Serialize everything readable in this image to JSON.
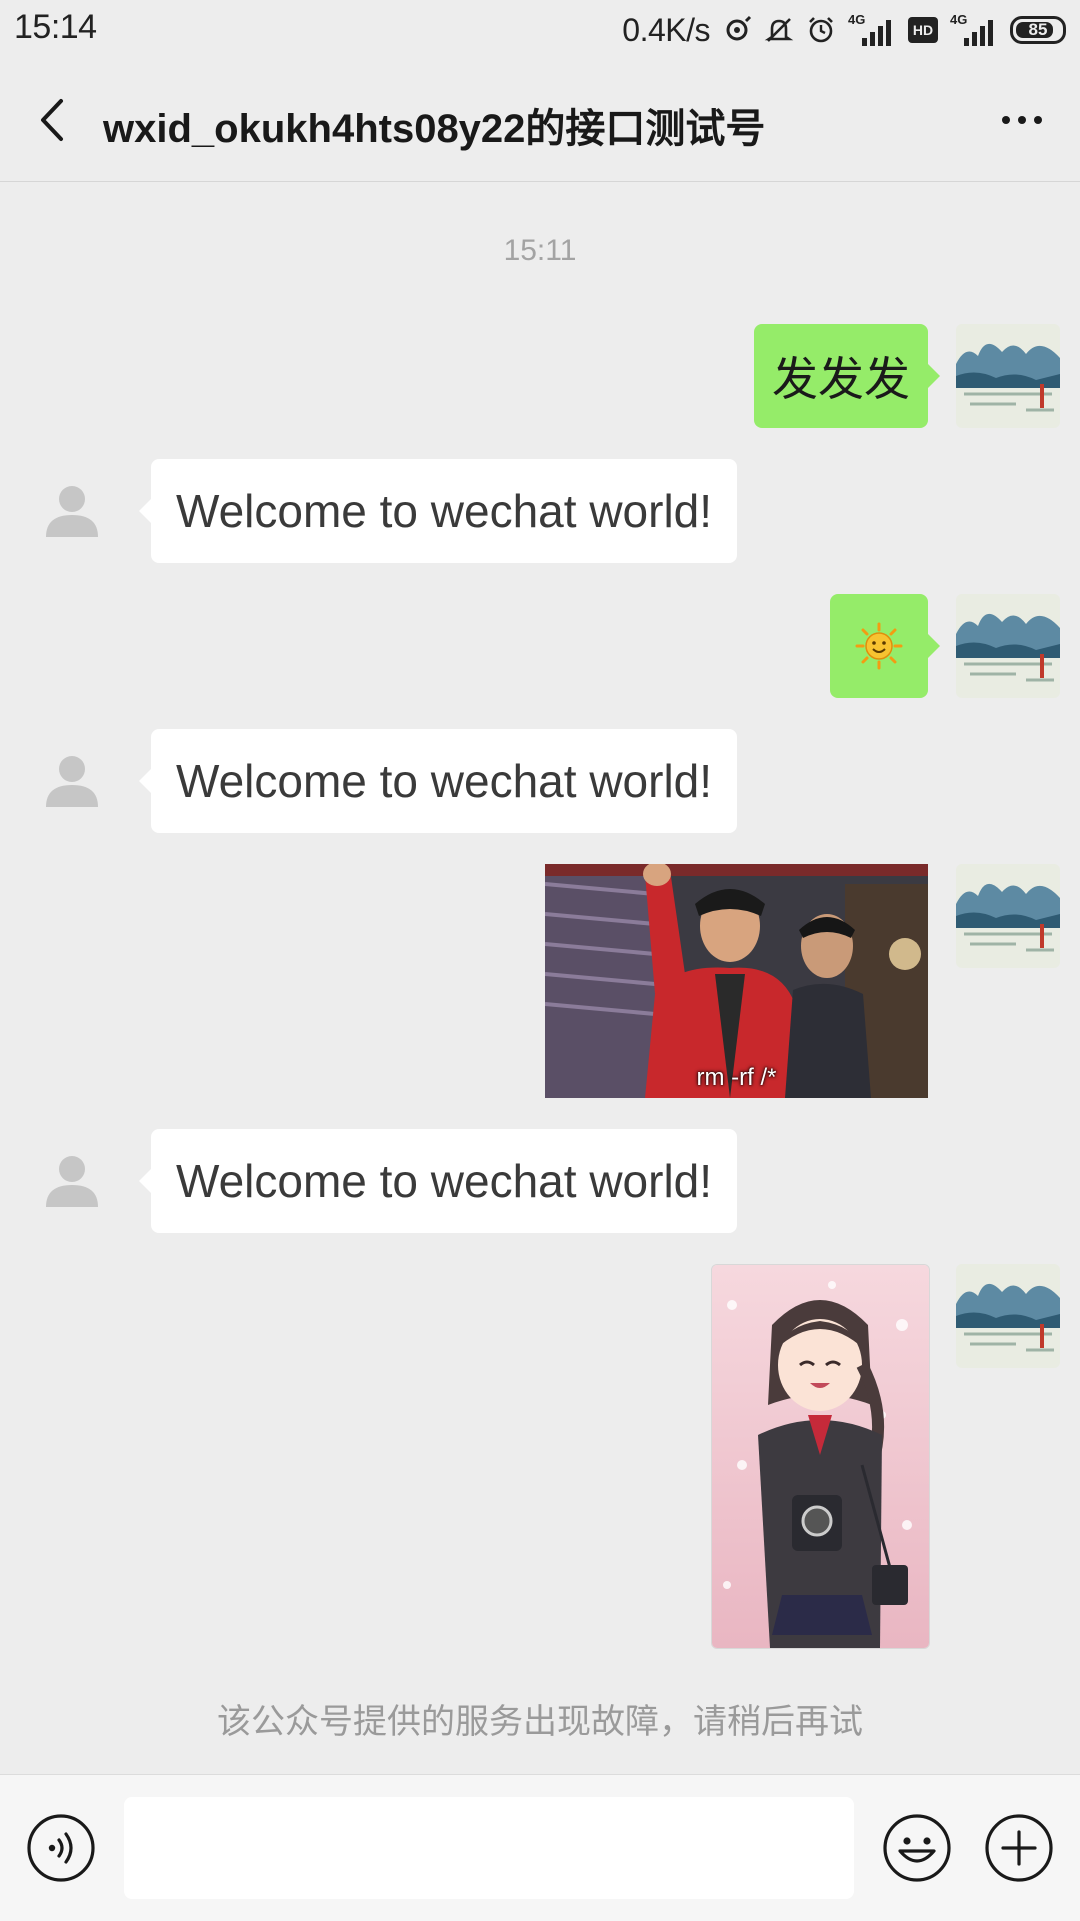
{
  "status_bar": {
    "time": "15:14",
    "net_speed": "0.4K/s",
    "signal1_label": "4G",
    "hd_label": "HD",
    "signal2_label": "4G",
    "battery": "85",
    "battery_level": 0.85
  },
  "header": {
    "title": "wxid_okukh4hts08y22的接口测试号"
  },
  "chat": {
    "timestamp": "15:11",
    "messages": [
      {
        "side": "sent",
        "type": "text",
        "text": "发发发"
      },
      {
        "side": "received",
        "type": "text",
        "text": "Welcome to wechat world!"
      },
      {
        "side": "sent",
        "type": "emoji",
        "emoji": "sun-emoji"
      },
      {
        "side": "received",
        "type": "text",
        "text": "Welcome to wechat world!"
      },
      {
        "side": "sent",
        "type": "image",
        "caption": "rm -rf /*"
      },
      {
        "side": "received",
        "type": "text",
        "text": "Welcome to wechat world!"
      },
      {
        "side": "sent",
        "type": "image",
        "caption": ""
      }
    ],
    "system_notice": "该公众号提供的服务出现故障，请稍后再试"
  },
  "input_bar": {
    "placeholder": "",
    "voice_icon": "voice-icon",
    "emoji_icon": "emoji-icon",
    "plus_icon": "plus-icon"
  },
  "colors": {
    "background": "#ededed",
    "sent_bubble": "#95ec69",
    "received_bubble": "#ffffff",
    "muted_text": "#a3a3a3"
  }
}
